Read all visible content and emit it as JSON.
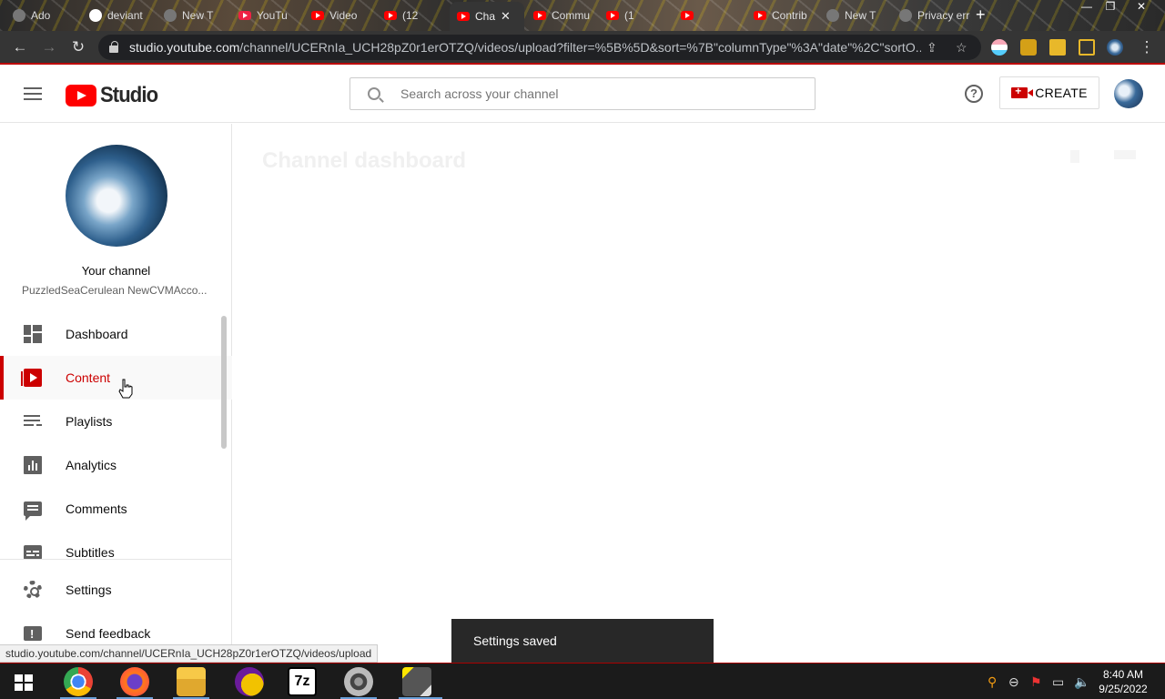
{
  "browser": {
    "tabs": [
      {
        "label": "Ado",
        "icon": "generic-tab-icon"
      },
      {
        "label": "deviant",
        "icon": "google-icon"
      },
      {
        "label": "New T",
        "icon": "github-icon"
      },
      {
        "label": "YouTu",
        "icon": "download-icon"
      },
      {
        "label": "Video",
        "icon": "youtube-icon"
      },
      {
        "label": "(12",
        "icon": "youtube-icon"
      },
      {
        "label": "Cha",
        "icon": "youtube-icon",
        "active": true
      },
      {
        "label": "Commu",
        "icon": "youtube-icon"
      },
      {
        "label": "(1",
        "icon": "youtube-icon"
      },
      {
        "label": "",
        "icon": "youtube-icon"
      },
      {
        "label": "Contrib",
        "icon": "youtube-icon"
      },
      {
        "label": "New T",
        "icon": "github-icon"
      },
      {
        "label": "Privacy error",
        "icon": "generic-tab-icon"
      }
    ],
    "url_host": "studio.youtube.com",
    "url_path": "/channel/UCERnIa_UCH28pZ0r1erOTZQ/videos/upload?filter=%5B%5D&sort=%7B\"columnType\"%3A\"date\"%2C\"sortO...",
    "status_url": "studio.youtube.com/channel/UCERnIa_UCH28pZ0r1erOTZQ/videos/upload"
  },
  "header": {
    "logo_text": "Studio",
    "search_placeholder": "Search across your channel",
    "create_label": "CREATE"
  },
  "sidebar": {
    "channel_title": "Your channel",
    "channel_handle": "PuzzledSeaCerulean NewCVMAcco...",
    "items": [
      {
        "label": "Dashboard",
        "icon": "dashboard-icon"
      },
      {
        "label": "Content",
        "icon": "content-icon",
        "active": true
      },
      {
        "label": "Playlists",
        "icon": "playlists-icon"
      },
      {
        "label": "Analytics",
        "icon": "analytics-icon"
      },
      {
        "label": "Comments",
        "icon": "comments-icon"
      },
      {
        "label": "Subtitles",
        "icon": "subtitles-icon"
      }
    ],
    "bottom_items": [
      {
        "label": "Settings",
        "icon": "settings-icon"
      },
      {
        "label": "Send feedback",
        "icon": "feedback-icon"
      }
    ]
  },
  "main": {
    "title": "Channel dashboard"
  },
  "toast": {
    "message": "Settings saved"
  },
  "taskbar": {
    "time": "8:40 AM",
    "date": "9/25/2022",
    "apps": [
      "chrome-icon",
      "firefox-icon",
      "file-explorer-icon",
      "yahoo-messenger-icon",
      "7zip-icon",
      "video-app-icon",
      "image-app-icon"
    ]
  },
  "colors": {
    "brand_red": "#cc0000",
    "youtube_red": "#ff0000",
    "toast_bg": "#282828"
  }
}
